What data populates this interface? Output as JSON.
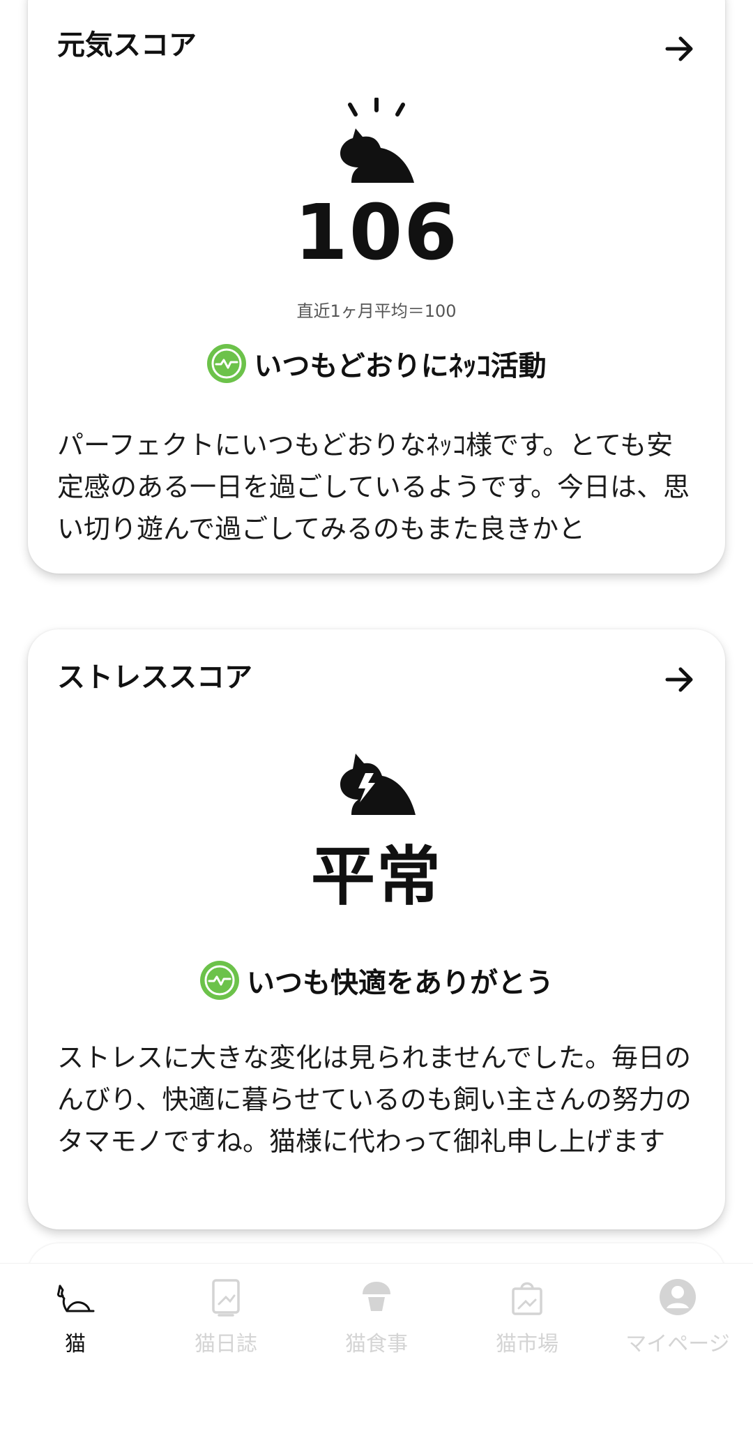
{
  "genki_card": {
    "title": "元気スコア",
    "score": "106",
    "average_label": "直近1ヶ月平均＝100",
    "status_text": "いつもどおりにﾈｯｺ活動",
    "description": "パーフェクトにいつもどおりなﾈｯｺ様です。とても安定感のある一日を過ごしているようです。今日は、思い切り遊んで過ごしてみるのもまた良きかと"
  },
  "stress_card": {
    "title": "ストレススコア",
    "level": "平常",
    "status_text": "いつも快適をありがとう",
    "description": "ストレスに大きな変化は見られませんでした。毎日のんびり、快適に暮らせているのも飼い主さんの努力のタマモノですね。猫様に代わって御礼申し上げます"
  },
  "bottom_nav": {
    "items": [
      {
        "label": "猫",
        "icon": "cat-icon",
        "active": true
      },
      {
        "label": "猫日誌",
        "icon": "diary-icon",
        "active": false
      },
      {
        "label": "猫食事",
        "icon": "food-icon",
        "active": false
      },
      {
        "label": "猫市場",
        "icon": "shopping-bag-icon",
        "active": false
      },
      {
        "label": "マイページ",
        "icon": "user-icon",
        "active": false
      }
    ]
  },
  "colors": {
    "status_green": "#6CC24A",
    "text": "#111111",
    "inactive_nav": "#d4d4d4"
  }
}
